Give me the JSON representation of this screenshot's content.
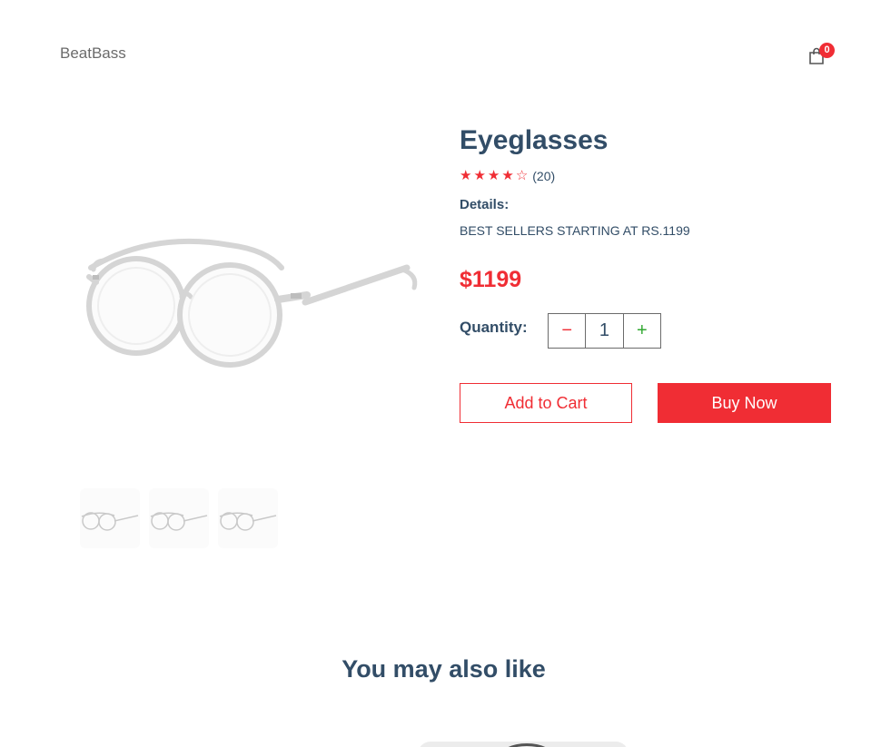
{
  "navbar": {
    "logo": "BeatBass",
    "cart_qty": "0",
    "cart_icon": "shopping-bag-icon"
  },
  "product": {
    "name": "Eyeglasses",
    "stars": [
      "★",
      "★",
      "★",
      "★",
      "☆"
    ],
    "rating": 4,
    "review_count": "(20)",
    "details_label": "Details:",
    "details": "BEST SELLERS STARTING AT RS.1199",
    "price": "$1199",
    "quantity_label": "Quantity:",
    "quantity": "1",
    "minus_symbol": "−",
    "plus_symbol": "+",
    "add_to_cart": "Add to Cart",
    "buy_now": "Buy Now",
    "thumbnails": [
      "eyeglasses",
      "eyeglasses",
      "eyeglasses"
    ]
  },
  "also_like": {
    "title": "You may also like"
  },
  "colors": {
    "accent": "#f02d34",
    "heading": "#324d67",
    "plus": "#31a831"
  }
}
